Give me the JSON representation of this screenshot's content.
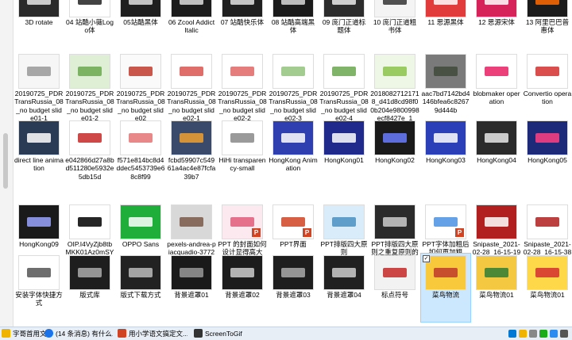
{
  "files": [
    {
      "label": "3D rotate",
      "thumb": "#2a2a2a",
      "accent": "#e8e8e8"
    },
    {
      "label": "04 站酷小薇Logo体",
      "thumb": "#ffffff",
      "accent": "#222222"
    },
    {
      "label": "05站酷黑体",
      "thumb": "#1e1e1e",
      "accent": "#e0e0e0"
    },
    {
      "label": "06 Zcool Addict Italic",
      "thumb": "#1c1c1c",
      "accent": "#dddddd"
    },
    {
      "label": "07 站酷快乐体",
      "thumb": "#202020",
      "accent": "#e4e4e4"
    },
    {
      "label": "08 站酷高端黑体",
      "thumb": "#1a1a1a",
      "accent": "#d9d9d9"
    },
    {
      "label": "09 庞门正道标题体",
      "thumb": "#2c2c2c",
      "accent": "#ececec"
    },
    {
      "label": "10 庞门正道粗书体",
      "thumb": "#f4f4f4",
      "accent": "#333333"
    },
    {
      "label": "11 思源黑体",
      "thumb": "#e23b3b",
      "accent": "#ffffff"
    },
    {
      "label": "12 思源宋体",
      "thumb": "#d6245a",
      "accent": "#ffffff"
    },
    {
      "label": "13 阿里巴巴普惠体",
      "thumb": "#1b1b1b",
      "accent": "#ff6a00"
    },
    {
      "label": "20190725_PDR TransRussia_08_no budget slide01-1",
      "thumb": "#f6f6f6",
      "accent": "#999999"
    },
    {
      "label": "20190725_PDR TransRussia_08_no budget slide01-2",
      "thumb": "#dfefd5",
      "accent": "#6aa84f"
    },
    {
      "label": "20190725_PDR TransRussia_08_no budget slide02",
      "thumb": "#fafafa",
      "accent": "#c0392b"
    },
    {
      "label": "20190725_PDR TransRussia_08_no budget slide02-1",
      "thumb": "#ffffff",
      "accent": "#d9534f"
    },
    {
      "label": "20190725_PDR TransRussia_08_no budget slide02-2",
      "thumb": "#ffffff",
      "accent": "#e06666"
    },
    {
      "label": "20190725_PDR TransRussia_08_no budget slide02-3",
      "thumb": "#ffffff",
      "accent": "#93c47d"
    },
    {
      "label": "20190725_PDR TransRussia_08_no budget slide02-4",
      "thumb": "#ffffff",
      "accent": "#6aa84f"
    },
    {
      "label": "2018082712171 8_d41d8cd98f00b204e9800998ecf8427e_1",
      "thumb": "#eef6e6",
      "accent": "#8bc34a"
    },
    {
      "label": "aac7bd7142bd4146bfea6c82679d444b",
      "thumb": "#7a7a7a",
      "accent": "#3f4a3a"
    },
    {
      "label": "blobmaker operation",
      "thumb": "#ffffff",
      "accent": "#e91e63"
    },
    {
      "label": "Convertio operation",
      "thumb": "#ffffff",
      "accent": "#d32f2f"
    },
    {
      "label": "direct line animation",
      "thumb": "#2a3b55",
      "accent": "#ffffff"
    },
    {
      "label": "e042866d27a8bd511280e5932e5db15d",
      "thumb": "#ffffff",
      "accent": "#c62828"
    },
    {
      "label": "f571e814bc8d4ddec5453739e68c8f99",
      "thumb": "#ffffff",
      "accent": "#e57373"
    },
    {
      "label": "fcbd59907c54961a4ac4e87fcfa39b7",
      "thumb": "#3a4a6a",
      "accent": "#f0a030"
    },
    {
      "label": "HiHi transparency-small",
      "thumb": "#ffffff",
      "accent": "#888888"
    },
    {
      "label": "HongKong Animation",
      "thumb": "#2f3fb0",
      "accent": "#ffffff"
    },
    {
      "label": "HongKong01",
      "thumb": "#1f2a8c",
      "accent": "#ffffff"
    },
    {
      "label": "HongKong02",
      "thumb": "#1a1a1a",
      "accent": "#6b7cff"
    },
    {
      "label": "HongKong03",
      "thumb": "#2a3fb8",
      "accent": "#ffffff"
    },
    {
      "label": "HongKong04",
      "thumb": "#2b2b2b",
      "accent": "#e8e8e8"
    },
    {
      "label": "HongKong05",
      "thumb": "#1d2a7a",
      "accent": "#ff4081"
    },
    {
      "label": "HongKong09",
      "thumb": "#1a1a1a",
      "accent": "#9aa4ff"
    },
    {
      "label": "OIP.I4VyZjb8tbMKK01Az0mSYwHaD0",
      "thumb": "#ffffff",
      "accent": "#000000"
    },
    {
      "label": "OPPO Sans",
      "thumb": "#1fae3a",
      "accent": "#ffffff"
    },
    {
      "label": "pexels-andrea-piacquadio-377261701",
      "thumb": "#d8d8d8",
      "accent": "#7a5a4a"
    },
    {
      "label": "PPT 的封面如何设计显得高大上?",
      "thumb": "#fbe9ef",
      "accent": "#e05a7a",
      "badge": "P"
    },
    {
      "label": "PPT界面",
      "thumb": "#ffffff",
      "accent": "#d04423",
      "badge": "P"
    },
    {
      "label": "PPT排版四大原则",
      "thumb": "#d8ecfa",
      "accent": "#4a90c2"
    },
    {
      "label": "PPT排版四大原则之重复原则的案例",
      "thumb": "#2b2b2b",
      "accent": "#cccccc"
    },
    {
      "label": "PPT字体加粗后如何再加粗",
      "thumb": "#ffffff",
      "accent": "#4a90e2",
      "badge": "P"
    },
    {
      "label": "Snipaste_2021-02-28_16-15-19",
      "thumb": "#b21f1f",
      "accent": "#ffffff"
    },
    {
      "label": "Snipaste_2021-02-28_16-15-38",
      "thumb": "#ffffff",
      "accent": "#b21f1f"
    },
    {
      "label": "安装字体快捷方式",
      "thumb": "#ffffff",
      "accent": "#555555"
    },
    {
      "label": "版式库",
      "thumb": "#1e1e1e",
      "accent": "#aaaaaa"
    },
    {
      "label": "版式下载方式",
      "thumb": "#222222",
      "accent": "#bbbbbb"
    },
    {
      "label": "背景遮罩01",
      "thumb": "#1a1a1a",
      "accent": "#999999"
    },
    {
      "label": "背景遮罩02",
      "thumb": "#1c1c1c",
      "accent": "#cccccc"
    },
    {
      "label": "背景遮罩03",
      "thumb": "#1e1e1e",
      "accent": "#aaaaaa"
    },
    {
      "label": "背景遮罩04",
      "thumb": "#202020",
      "accent": "#cccccc"
    },
    {
      "label": "标点符号",
      "thumb": "#f2f2f2",
      "accent": "#c62828"
    },
    {
      "label": "菜鸟物流",
      "thumb": "#f8c93a",
      "accent": "#c0392b",
      "selected": true
    },
    {
      "label": "菜鸟物流01",
      "thumb": "#f5c842",
      "accent": "#2e7d32"
    },
    {
      "label": "菜鸟物流01",
      "thumb": "#ffd84a",
      "accent": "#d32f2f"
    }
  ],
  "taskbar": {
    "items": [
      {
        "label": "字哥首用文件",
        "color": "#f0b400"
      },
      {
        "label": "(14 条消息) 有什么...",
        "color": "#1a73e8"
      },
      {
        "label": "用小学语文搞定文...",
        "color": "#d04423"
      },
      {
        "label": "ScreenToGif",
        "color": "#333333"
      }
    ],
    "tray_colors": [
      "#0078d4",
      "#f0b400",
      "#888888",
      "#1aad19",
      "#2d8cf0",
      "#555555"
    ]
  }
}
